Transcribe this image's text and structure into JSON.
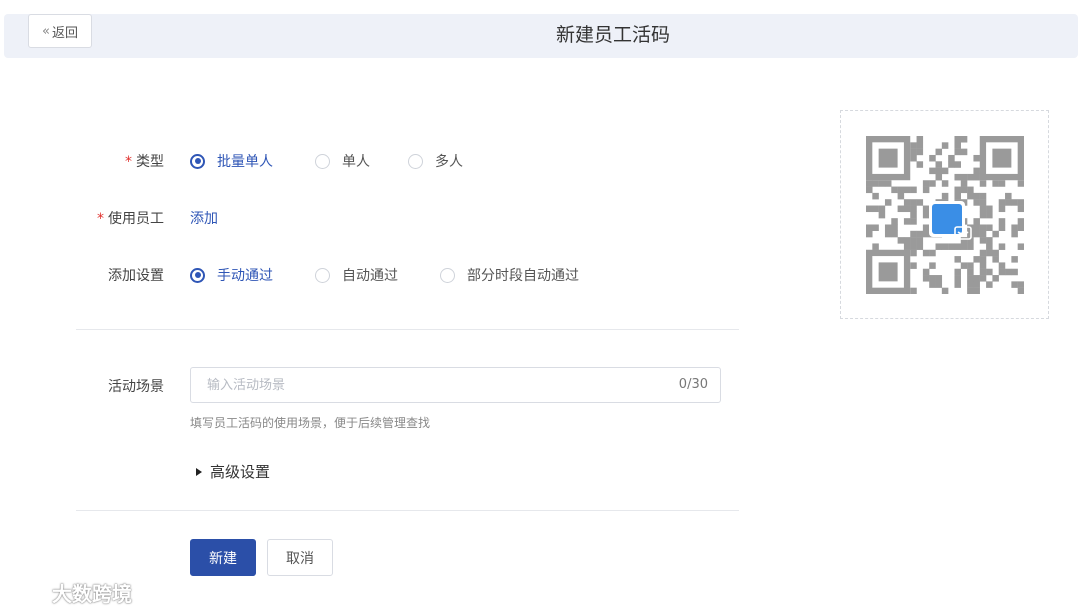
{
  "header": {
    "back_label": "返回",
    "title": "新建员工活码"
  },
  "form": {
    "type": {
      "label": "类型",
      "required": true,
      "options": [
        "批量单人",
        "单人",
        "多人"
      ],
      "selected": "批量单人"
    },
    "staff": {
      "label": "使用员工",
      "required": true,
      "action": "添加"
    },
    "add_setting": {
      "label": "添加设置",
      "options": [
        "手动通过",
        "自动通过",
        "部分时段自动通过"
      ],
      "selected": "手动通过"
    },
    "scene": {
      "label": "活动场景",
      "placeholder": "输入活动场景",
      "value": "",
      "counter": "0/30",
      "hint": "填写员工活码的使用场景，便于后续管理查找"
    },
    "advanced_label": "高级设置",
    "submit_label": "新建",
    "cancel_label": "取消"
  },
  "watermark": {
    "text": "大数跨境"
  },
  "colors": {
    "primary": "#2b4fa8",
    "required": "#e0302d",
    "header_bg": "#eef1f8",
    "qr_center": "#3a8ee6"
  },
  "icons": {
    "back": "chevron-left-double-icon",
    "qr": "qr-code-icon",
    "advanced": "caret-right-icon"
  }
}
